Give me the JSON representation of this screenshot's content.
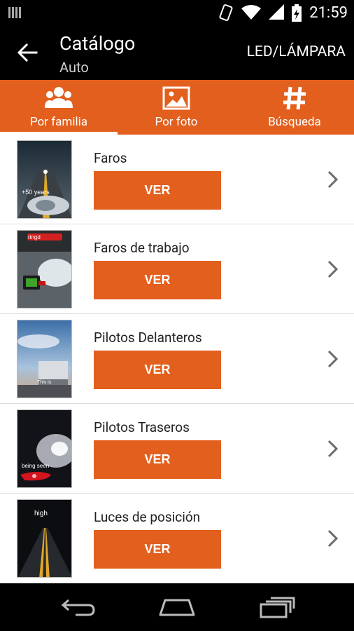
{
  "status_bar": {
    "time": "21:59"
  },
  "app_bar": {
    "title": "Catálogo",
    "subtitle": "Auto",
    "action": "LED/LÁMPARA"
  },
  "tabs": [
    {
      "label": "Por familia",
      "icon": "group-icon",
      "active": true
    },
    {
      "label": "Por foto",
      "icon": "image-icon",
      "active": false
    },
    {
      "label": "Búsqueda",
      "icon": "hash-icon",
      "active": false
    }
  ],
  "items": [
    {
      "name": "Faros",
      "button": "VER",
      "thumb_text": "+50 years"
    },
    {
      "name": "Faros de trabajo",
      "button": "VER",
      "thumb_text": "ringd"
    },
    {
      "name": "Pilotos Delanteros",
      "button": "VER",
      "thumb_text": "This is"
    },
    {
      "name": "Pilotos Traseros",
      "button": "VER",
      "thumb_text": "being seen"
    },
    {
      "name": "Luces de posición",
      "button": "VER",
      "thumb_text": "high"
    }
  ],
  "colors": {
    "accent": "#e35f1d",
    "bar": "#000000",
    "divider": "#dcdcdc"
  }
}
